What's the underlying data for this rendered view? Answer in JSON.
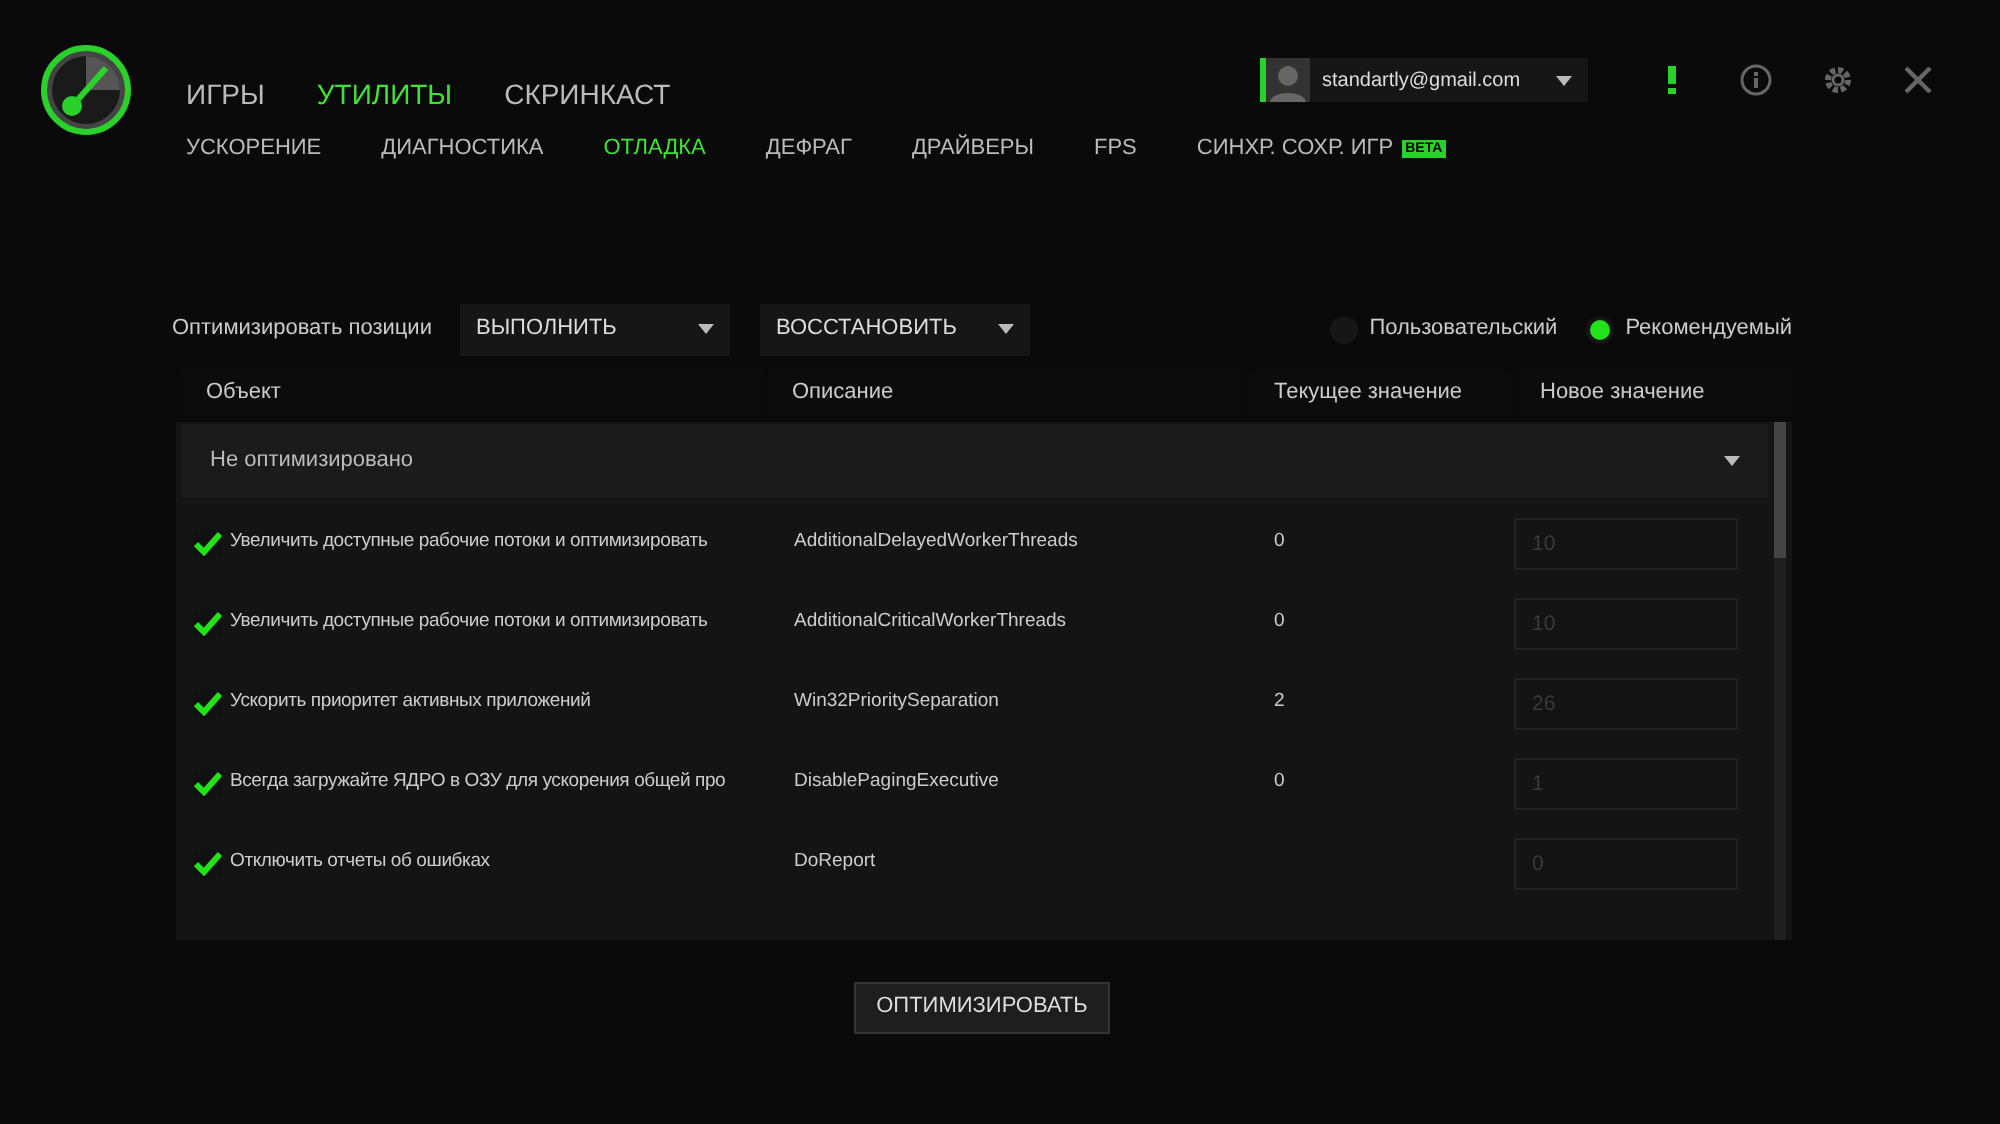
{
  "main_tabs": [
    {
      "label": "ИГРЫ",
      "selected": false
    },
    {
      "label": "УТИЛИТЫ",
      "selected": true
    },
    {
      "label": "СКРИНКАСТ",
      "selected": false
    }
  ],
  "sub_tabs": [
    {
      "label": "УСКОРЕНИЕ",
      "selected": false
    },
    {
      "label": "ДИАГНОСТИКА",
      "selected": false
    },
    {
      "label": "ОТЛАДКА",
      "selected": true
    },
    {
      "label": "ДЕФРАГ",
      "selected": false
    },
    {
      "label": "ДРАЙВЕРЫ",
      "selected": false
    },
    {
      "label": "FPS",
      "selected": false
    },
    {
      "label": "СИНХР. СОХР. ИГР",
      "selected": false,
      "badge": "BETA"
    }
  ],
  "account": {
    "email": "standartly@gmail.com"
  },
  "toolbar": {
    "label": "Оптимизировать позиции",
    "run": "ВЫПОЛНИТЬ",
    "restore": "ВОССТАНОВИТЬ"
  },
  "modes": [
    {
      "label": "Пользовательский",
      "selected": false
    },
    {
      "label": "Рекомендуемый",
      "selected": true
    }
  ],
  "table": {
    "columns": [
      "Объект",
      "Описание",
      "Текущее значение",
      "Новое значение"
    ],
    "group": "Не оптимизировано",
    "rows": [
      {
        "checked": true,
        "object": "Увеличить доступные рабочие потоки и оптимизировать",
        "description": "AdditionalDelayedWorkerThreads",
        "current": "0",
        "new": "10"
      },
      {
        "checked": true,
        "object": "Увеличить доступные рабочие потоки и оптимизировать",
        "description": "AdditionalCriticalWorkerThreads",
        "current": "0",
        "new": "10"
      },
      {
        "checked": true,
        "object": "Ускорить приоритет активных приложений",
        "description": "Win32PrioritySeparation",
        "current": "2",
        "new": "26"
      },
      {
        "checked": true,
        "object": "Всегда загружайте ЯДРО в ОЗУ для ускорения общей про",
        "description": "DisablePagingExecutive",
        "current": "0",
        "new": "1"
      },
      {
        "checked": true,
        "object": "Отключить отчеты об ошибках",
        "description": "DoReport",
        "current": "",
        "new": "0"
      }
    ]
  },
  "optimize_button": "ОПТИМИЗИРОВАТЬ"
}
